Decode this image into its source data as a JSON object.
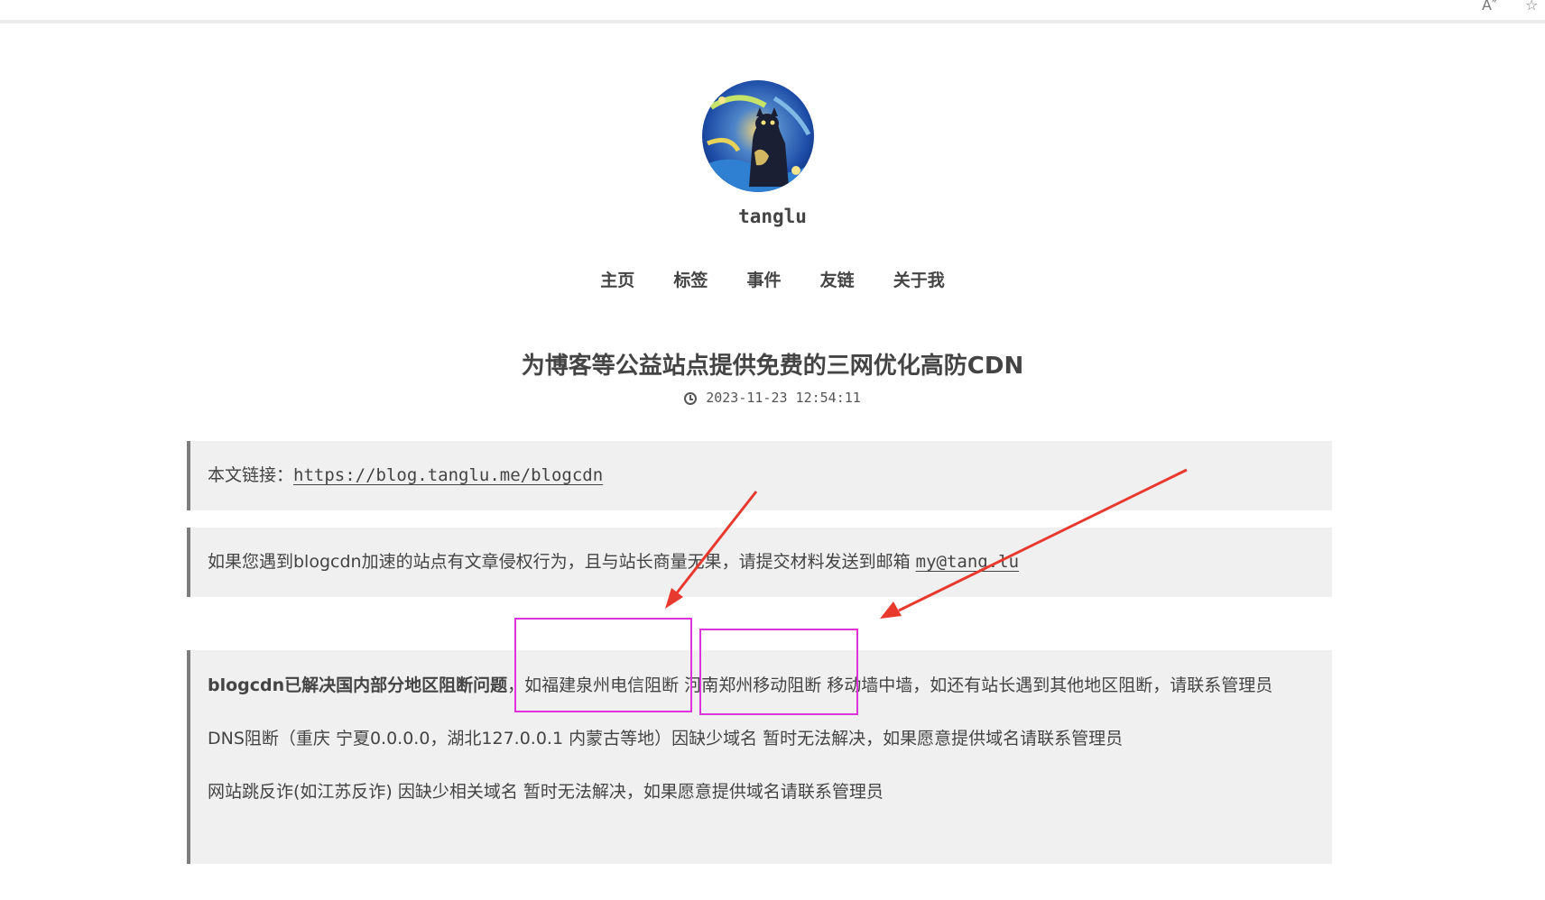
{
  "browser": {
    "read_aloud_icon": "A″",
    "favorite_icon": "☆"
  },
  "site": {
    "name": "tanglu",
    "avatar_icon": "avatar-image"
  },
  "nav": {
    "items": [
      "主页",
      "标签",
      "事件",
      "友链",
      "关于我"
    ]
  },
  "post": {
    "title": "为博客等公益站点提供免费的三网优化高防CDN",
    "date": "2023-11-23 12:54:11"
  },
  "quote1": {
    "prefix": "本文链接：",
    "link": "https://blog.tanglu.me/blogcdn"
  },
  "quote2": {
    "text": "如果您遇到blogcdn加速的站点有文章侵权行为，且与站长商量无果，请提交材料发送到邮箱 ",
    "email": "my@tang.lu"
  },
  "quote3": {
    "bold": "blogcdn已解决国内部分地区阻断问题",
    "p1_rest": "，如福建泉州电信阻断 河南郑州移动阻断 移动墙中墙，如还有站长遇到其他地区阻断，请联系管理员",
    "p2": "DNS阻断（重庆 宁夏0.0.0.0，湖北127.0.0.1 内蒙古等地）因缺少域名 暂时无法解决，如果愿意提供域名请联系管理员",
    "p3": "网站跳反诈(如江苏反诈) 因缺少相关域名 暂时无法解决，如果愿意提供域名请联系管理员"
  },
  "annotations": {
    "highlight_color": "#dd33dd",
    "arrow_color": "#e8392f"
  }
}
